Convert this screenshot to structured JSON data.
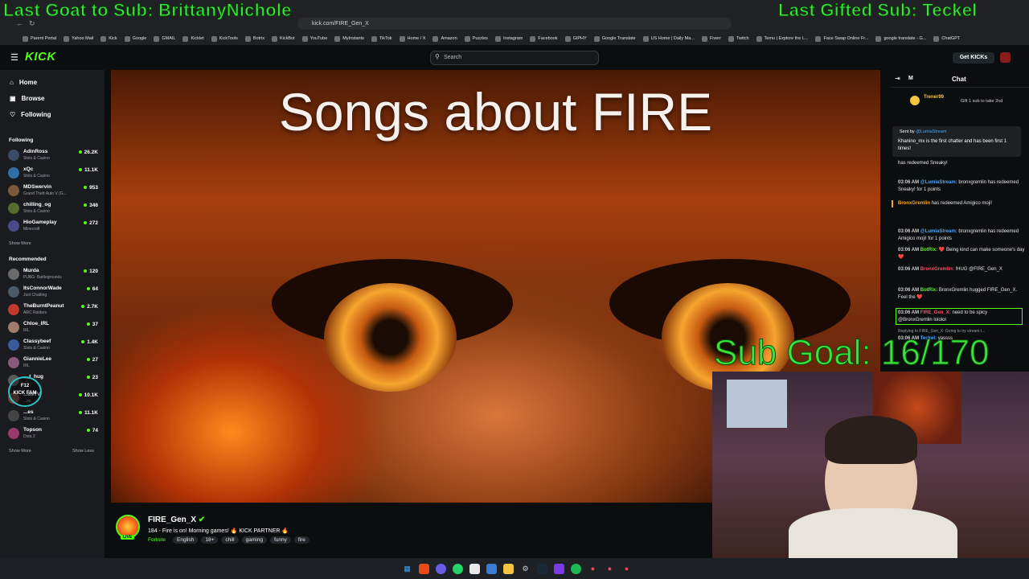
{
  "overlays": {
    "last_goat": "Last Goat to Sub: BrittanyNichole",
    "last_gifted": "Last Gifted Sub: Teckel",
    "sub_goal": "Sub Goal: 16/170",
    "fam_badge_line1": "F12",
    "fam_badge_line2": "KICK FAM"
  },
  "browser": {
    "url": "kick.com/FIRE_Gen_X",
    "bookmarks": [
      "Parent Portal",
      "Yahoo Mail",
      "Kick",
      "Google",
      "GMAIL",
      "Kicklet",
      "KickTools",
      "Botrix",
      "KickBot",
      "YouTube",
      "MyInstants",
      "TikTok",
      "Home / X",
      "Amazon",
      "Puzzles",
      "Instagram",
      "Facebook",
      "GIPHY",
      "Google Translate",
      "US Home | Daily Ma...",
      "Fiverr",
      "Twitch",
      "Temu | Explore the L...",
      "Face Swap Online Fr...",
      "google translate - G...",
      "ChatGPT"
    ]
  },
  "header": {
    "logo": "KICK",
    "search_placeholder": "Search",
    "get_kicks": "Get KICKs"
  },
  "sidebar": {
    "nav": [
      "Home",
      "Browse",
      "Following"
    ],
    "following_title": "Following",
    "following": [
      {
        "name": "AdinRoss",
        "category": "Slots & Casino",
        "viewers": "26.2K",
        "color": "#3a4a6b"
      },
      {
        "name": "xQc",
        "category": "Slots & Casino",
        "viewers": "11.1K",
        "color": "#2e6fa8"
      },
      {
        "name": "MDSwervin",
        "category": "Grand Theft Auto V (G...",
        "viewers": "953",
        "color": "#7a5a3a"
      },
      {
        "name": "chilling_og",
        "category": "Slots & Casino",
        "viewers": "346",
        "color": "#556b2f"
      },
      {
        "name": "HioGameplay",
        "category": "Minecraft",
        "viewers": "272",
        "color": "#4a4a8a"
      }
    ],
    "show_more_1": "Show More",
    "recommended_title": "Recommended",
    "recommended": [
      {
        "name": "Murda",
        "category": "PUBG: Battlegrounds",
        "viewers": "120",
        "color": "#6a6a6a"
      },
      {
        "name": "ItsConnorWade",
        "category": "Just Chatting",
        "viewers": "64",
        "color": "#4a5a6a"
      },
      {
        "name": "TheBurntPeanut",
        "category": "ARC Raiders",
        "viewers": "2.7K",
        "color": "#c0392b"
      },
      {
        "name": "Chloe_IRL",
        "category": "IRL",
        "viewers": "37",
        "color": "#a07a6a"
      },
      {
        "name": "Classybeef",
        "category": "Slots & Casino",
        "viewers": "1.4K",
        "color": "#3a5a9a"
      },
      {
        "name": "GiannieLee",
        "category": "IRL",
        "viewers": "27",
        "color": "#8a5a7a"
      },
      {
        "name": "__t_hug",
        "category": "",
        "viewers": "23",
        "color": "#5a5a5a"
      },
      {
        "name": "...osTV",
        "category": "...ze",
        "viewers": "10.1K",
        "color": "#6a4a3a"
      },
      {
        "name": "...es",
        "category": "Slots & Casino",
        "viewers": "11.1K",
        "color": "#444444"
      },
      {
        "name": "Topson",
        "category": "Dota 2",
        "viewers": "74",
        "color": "#9a3a6a"
      }
    ],
    "show_more_2": "Show More",
    "show_less": "Show Less"
  },
  "video": {
    "title": "Songs about FIRE"
  },
  "channel": {
    "name": "FIRE_Gen_X",
    "live": "LIVE",
    "title": "184 - Fire is on! Morning games! 🔥 KICK PARTNER 🔥",
    "category": "Fortnite",
    "tags": [
      "English",
      "18+",
      "chill",
      "gaming",
      "funny",
      "fire"
    ]
  },
  "chat": {
    "header": "Chat",
    "mode_letter": "M",
    "gift_user": "Trener99",
    "gift_text": "Gift 1 sub to take 2nd",
    "pinned_sender": "Sent by",
    "pinned_from": "@LumiaStream",
    "pinned_text": "Khanino_mx is the first chatter and has been first 1 times!",
    "messages": [
      {
        "time": "",
        "user": "",
        "text": "has redeemed Sneaky!",
        "color": "#ffffff"
      },
      {
        "time": "03:06 AM",
        "user": "@LumiaStream:",
        "text": "bronxgremlin has redeemed Sneaky! for 1 points",
        "color": "#49a6ff"
      },
      {
        "time": "",
        "user": "BronxGremlin",
        "text": "has redeemed Amigico moji!",
        "color": "#f5a623"
      },
      {
        "time": "03:06 AM",
        "user": "@LumiaStream:",
        "text": "bronxgremlin has redeemed Amigico moji! for 1 points",
        "color": "#49a6ff"
      },
      {
        "time": "03:06 AM",
        "user": "BotRix:",
        "text": "❤️ Being kind can make someone's day ❤️",
        "color": "#53fc18"
      },
      {
        "time": "03:06 AM",
        "user": "BronxGremlin:",
        "text": "!HUG @FIRE_Gen_X",
        "color": "#ff4a6a"
      },
      {
        "time": "03:06 AM",
        "user": "BotRix:",
        "text": "BronxGremlin hugged FIRE_Gen_X. Feel the ❤️",
        "color": "#53fc18"
      },
      {
        "time": "03:06 AM",
        "user": "FIRE_Gen_X:",
        "text": "need to be spicy @BronxGremlin lololol",
        "color": "#ff4a6a"
      },
      {
        "time": "03:06 AM",
        "user": "Teckel:",
        "text": "yassss",
        "color": "#49a6ff"
      }
    ],
    "reply_line": "Replying to FIRE_Gen_X: Going to try stream t..."
  }
}
